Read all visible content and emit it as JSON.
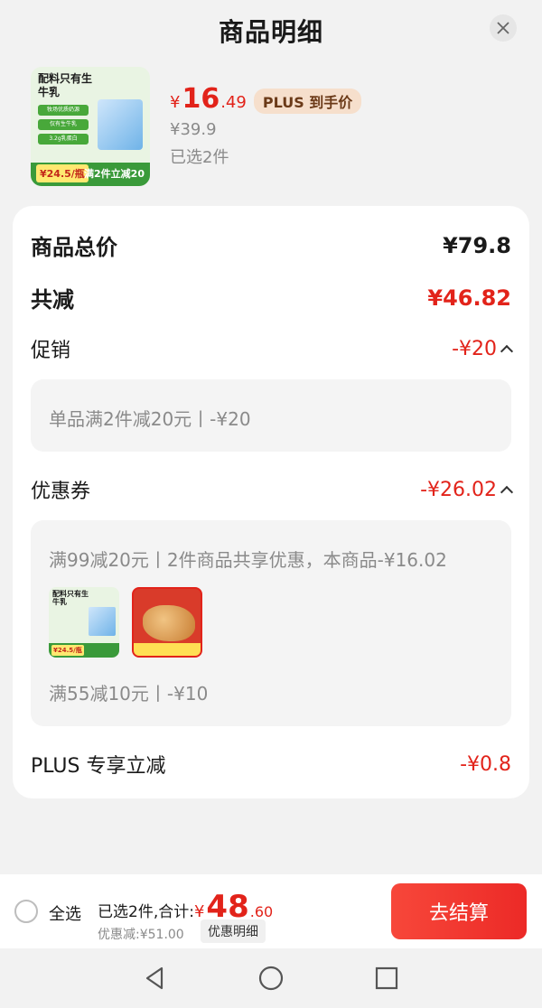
{
  "header": {
    "title": "商品明细"
  },
  "product": {
    "thumb": {
      "headline": "配料只有生牛乳",
      "chips": [
        "牧场优质奶源",
        "仅有生牛乳",
        "3.2g乳蛋白"
      ],
      "price_chip": "¥24.5/瓶",
      "promo": "满2件立减20"
    },
    "price_yen": "¥",
    "price_int": "16",
    "price_dec": ".49",
    "plus_tag": "PLUS 到手价",
    "original_price": "¥39.9",
    "selected": "已选2件"
  },
  "detail": {
    "total_label": "商品总价",
    "total_value": "¥79.8",
    "reduce_label": "共减",
    "reduce_value": "¥46.82",
    "promo_label": "促销",
    "promo_value": "-¥20",
    "promo_detail": "单品满2件减20元丨-¥20",
    "coupon_label": "优惠券",
    "coupon_value": "-¥26.02",
    "coupon_detail_1": "满99减20元丨2件商品共享优惠，本商品-¥16.02",
    "coupon_detail_2": "满55减10元丨-¥10",
    "plus_label": "PLUS 专享立减",
    "plus_value": "-¥0.8"
  },
  "bottom_bar": {
    "select_all": "全选",
    "summary_label": "已选2件,合计:",
    "total_yen": "¥",
    "total_int": "48",
    "total_dec": ".60",
    "saved": "优惠减:¥51.00",
    "detail_chip": "优惠明细",
    "checkout": "去结算"
  },
  "colors": {
    "accent_red": "#e2231a",
    "plus_tag_bg": "#f6dfcc"
  }
}
